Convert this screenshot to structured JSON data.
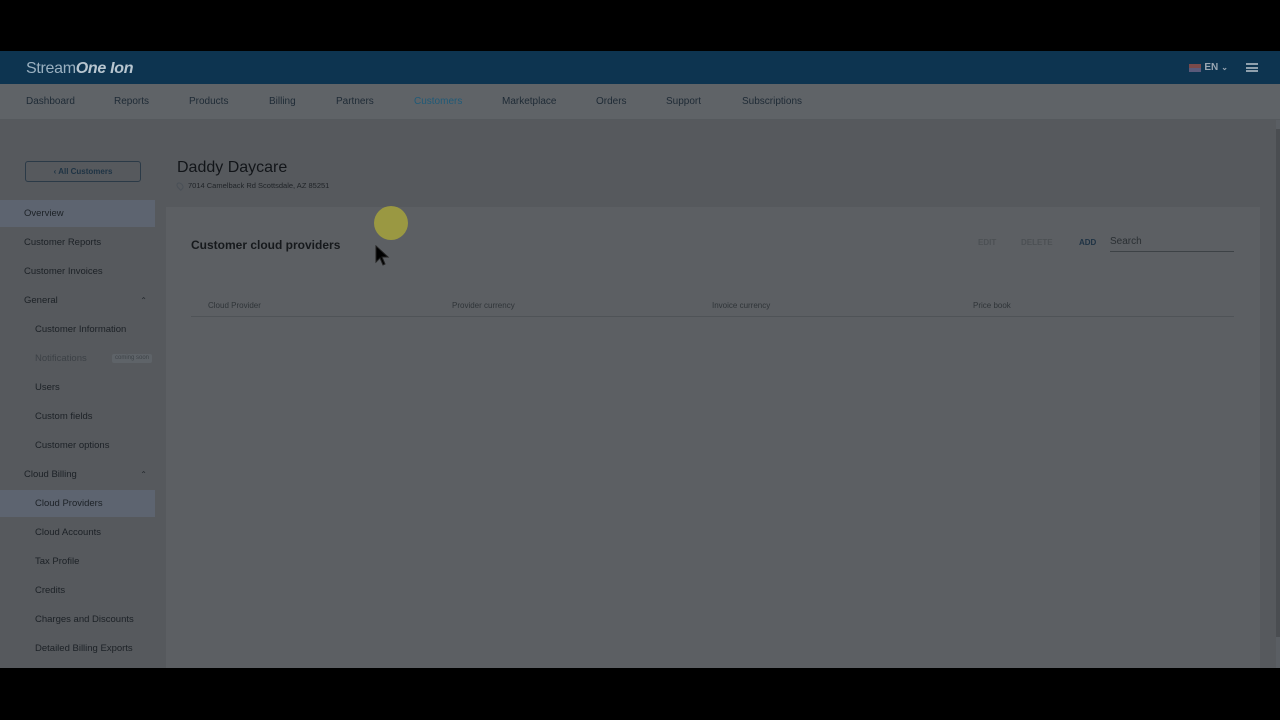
{
  "app": {
    "logo_light": "Stream",
    "logo_bold": "One",
    "logo_suffix": "Ion",
    "language": "EN"
  },
  "nav": {
    "items": [
      "Dashboard",
      "Reports",
      "Products",
      "Billing",
      "Partners",
      "Customers",
      "Marketplace",
      "Orders",
      "Support",
      "Subscriptions"
    ],
    "active": "Customers"
  },
  "customer": {
    "back_label": "All Customers",
    "name": "Daddy Daycare",
    "address": "7014 Camelback Rd Scottsdale, AZ 85251"
  },
  "sidebar": {
    "overview": "Overview",
    "customer_reports": "Customer Reports",
    "customer_invoices": "Customer Invoices",
    "general": "General",
    "customer_information": "Customer Information",
    "notifications": "Notifications",
    "coming_soon": "coming soon",
    "users": "Users",
    "custom_fields": "Custom fields",
    "customer_options": "Customer options",
    "cloud_billing": "Cloud Billing",
    "cloud_providers": "Cloud Providers",
    "cloud_accounts": "Cloud Accounts",
    "tax_profile": "Tax Profile",
    "credits": "Credits",
    "charges_and_discounts": "Charges and Discounts",
    "detailed_billing_exports": "Detailed Billing Exports"
  },
  "main": {
    "section_title": "Customer cloud providers",
    "edit_label": "EDIT",
    "delete_label": "DELETE",
    "add_label": "ADD",
    "search_placeholder": "Search",
    "columns": [
      "Cloud Provider",
      "Provider currency",
      "Invoice currency",
      "Price book"
    ]
  },
  "colors": {
    "topbar": "#0d3450",
    "active_nav": "#1f5a78",
    "cursor_highlight": "#a4a23c"
  }
}
